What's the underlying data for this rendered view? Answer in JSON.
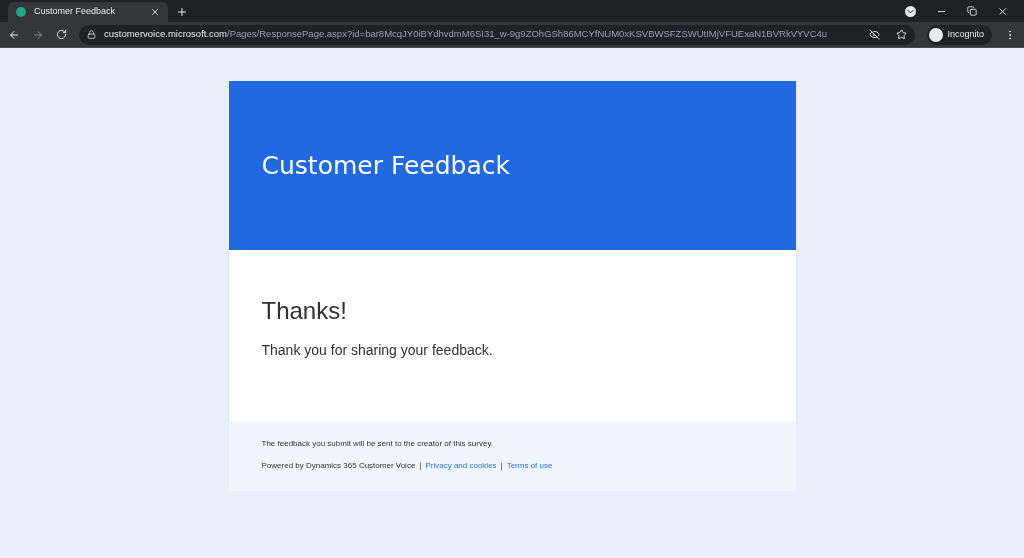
{
  "browser": {
    "tab": {
      "title": "Customer Feedback",
      "selected": true
    },
    "address": {
      "domain": "customervoice.microsoft.com",
      "path": "/Pages/ResponsePage.aspx?id=bar8McqJY0iBYdhvdmM6SI31_w-9g9ZOhGSh86MCYfNUM0xKSVBWSFZSWUtIMjVFUExaN1BVRkVYVC4u"
    },
    "profile": "Incognito"
  },
  "form": {
    "title": "Customer Feedback",
    "heading": "Thanks!",
    "message": "Thank you for sharing your feedback."
  },
  "footer": {
    "notice": "The feedback you submit will be sent to the creator of this survey.",
    "powered_by": "Powered by Dynamics 365 Customer Voice",
    "separators": [
      "|",
      "|"
    ],
    "links": [
      "Privacy and cookies",
      "Terms of use"
    ]
  }
}
